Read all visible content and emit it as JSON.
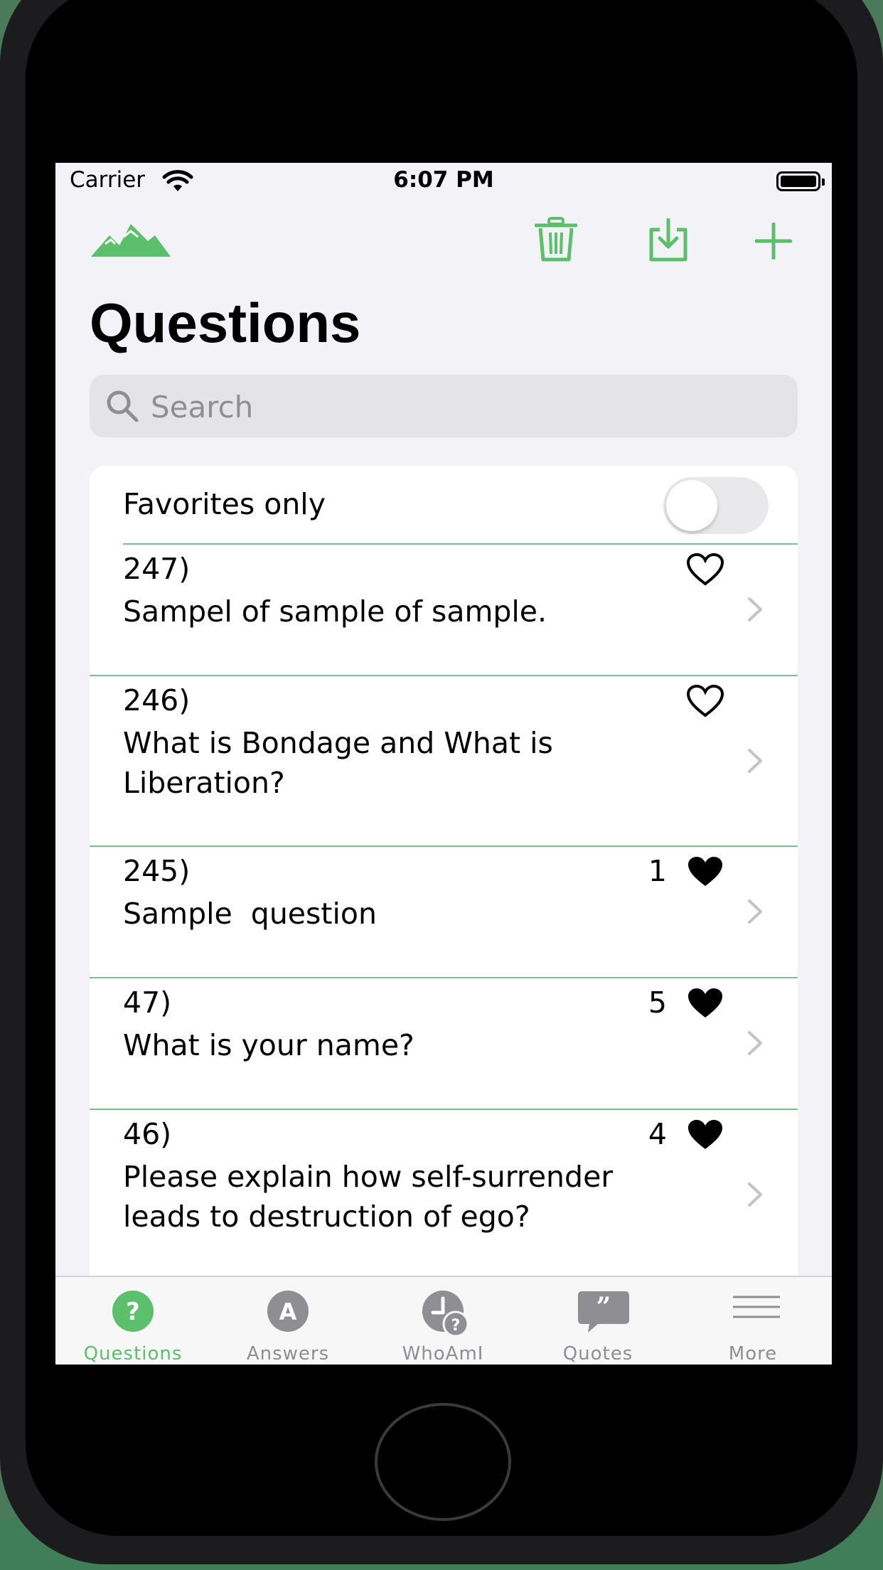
{
  "status_bar": {
    "carrier": "Carrier",
    "time": "6:07 PM"
  },
  "nav": {
    "title": "Questions",
    "icons": [
      "mountains-logo-icon",
      "trash-icon",
      "download-icon",
      "plus-icon"
    ]
  },
  "search": {
    "placeholder": "Search",
    "value": ""
  },
  "filter": {
    "favorites_label": "Favorites only",
    "favorites_on": false
  },
  "questions": [
    {
      "number": "247)",
      "text": "Sampel of sample of sample.",
      "likes": "",
      "favorited": false
    },
    {
      "number": "246)",
      "text": "What is Bondage and What is Liberation?",
      "likes": "",
      "favorited": false
    },
    {
      "number": "245)",
      "text": "Sample  question",
      "likes": "1",
      "favorited": true
    },
    {
      "number": "47)",
      "text": "What is your name?",
      "likes": "5",
      "favorited": true
    },
    {
      "number": "46)",
      "text": "Please explain how self-surrender leads to destruction of ego?",
      "likes": "4",
      "favorited": true
    }
  ],
  "tabs": [
    {
      "label": "Questions",
      "icon": "question-circle-icon",
      "active": true
    },
    {
      "label": "Answers",
      "icon": "letter-a-circle-icon",
      "active": false
    },
    {
      "label": "WhoAmI",
      "icon": "clock-question-icon",
      "active": false
    },
    {
      "label": "Quotes",
      "icon": "quote-bubble-icon",
      "active": false
    },
    {
      "label": "More",
      "icon": "hamburger-lines-icon",
      "active": false
    }
  ],
  "colors": {
    "accent": "#5cbf6b",
    "separator": "#7cc08b",
    "inactive": "#8e8e93",
    "background": "#f2f2f7"
  }
}
